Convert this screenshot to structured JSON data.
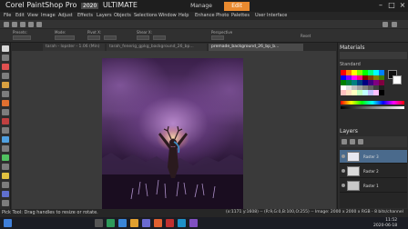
{
  "window": {
    "title_prefix": "Corel",
    "title_app": "PaintShop Pro",
    "title_version": "2020",
    "title_edition": "ULTIMATE",
    "tabs": [
      "Manage",
      "Edit"
    ],
    "active_tab": "Edit"
  },
  "menu": [
    "File",
    "Edit",
    "View",
    "Image",
    "Adjust",
    "Effects",
    "Layers",
    "Objects",
    "Selections",
    "Window",
    "Help",
    "Enhance Photo",
    "Palettes",
    "User Interface"
  ],
  "toolbar": {
    "preset_label": "Presets:",
    "mode_label": "Mode:",
    "pivot_label": "Pivot X:",
    "perspective_label": "Perspective",
    "shear_label": "Shear X:",
    "reset_label": "Reset"
  },
  "documents": [
    {
      "label": "tarah - lopster - 1.06 (Min)",
      "active": false
    },
    {
      "label": "tarah_fenerig_gpkg_background_26_bp...",
      "active": false
    },
    {
      "label": "premade_background_26_bp_b...",
      "active": true
    }
  ],
  "panels": {
    "materials_title": "Materials",
    "materials_tab": "Standard",
    "layers_title": "Layers",
    "layers": [
      {
        "name": "Raster 3",
        "active": true
      },
      {
        "name": "Raster 2",
        "active": false
      },
      {
        "name": "Raster 1",
        "active": false
      }
    ]
  },
  "status": {
    "left": "Pick Tool: Drag handles to resize or rotate.",
    "right": "(x:1171 y:1608) -- (R:9,G:0,B:100,O:255) -- Image: 2000 x 2000 x RGB - 8 bits/channel"
  },
  "taskbar": {
    "time": "11:52",
    "date": "2020-06-18"
  },
  "colors": {
    "accent": "#e98a2f",
    "selected_layer": "#4a6a8c"
  }
}
